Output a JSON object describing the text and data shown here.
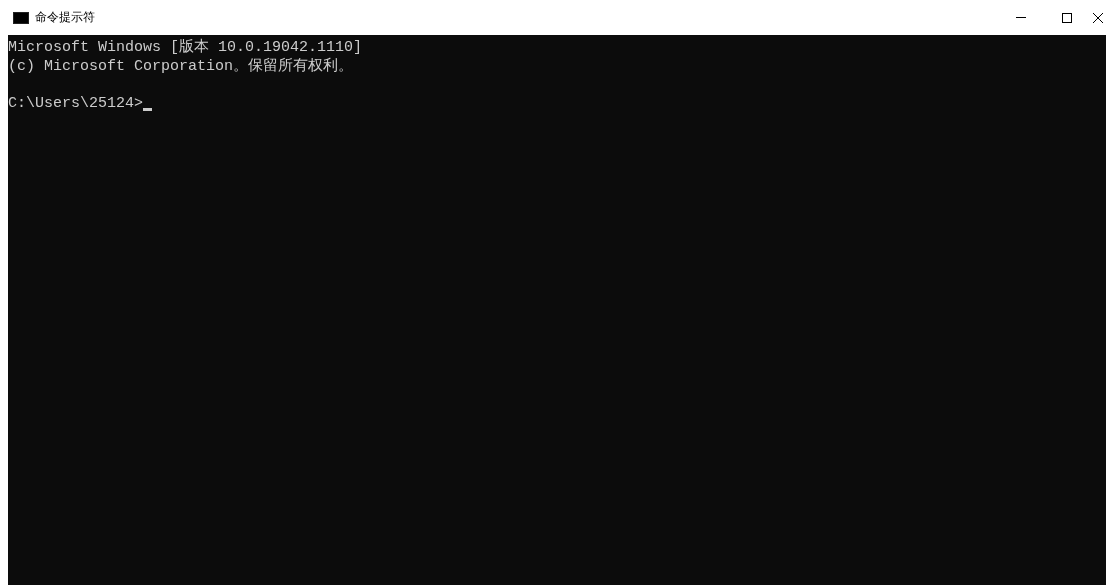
{
  "window": {
    "title": "命令提示符"
  },
  "console": {
    "blocks": [
      {
        "lines": [
          "Microsoft Windows [版本 10.0.19042.1110]",
          "(c) Microsoft Corporation。保留所有权利。"
        ]
      },
      {
        "lines": [
          "C:\\Users\\25124>"
        ]
      }
    ],
    "cursor": true
  }
}
